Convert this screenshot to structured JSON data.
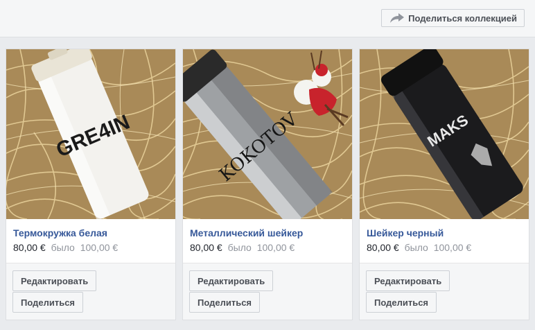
{
  "header": {
    "share_collection_label": "Поделиться коллекцией"
  },
  "products": [
    {
      "title": "Термокружка белая",
      "price": "80,00 €",
      "old_label": "было",
      "old_price": "100,00 €",
      "bottle_text": "GRE4IN",
      "edit_label": "Редактировать",
      "share_label": "Поделиться"
    },
    {
      "title": "Металлический шейкер",
      "price": "80,00 €",
      "old_label": "было",
      "old_price": "100,00 €",
      "bottle_text": "KOKOTOV",
      "edit_label": "Редактировать",
      "share_label": "Поделиться"
    },
    {
      "title": "Шейкер черный",
      "price": "80,00 €",
      "old_label": "было",
      "old_price": "100,00 €",
      "bottle_text": "MAKS",
      "edit_label": "Редактировать",
      "share_label": "Поделиться"
    }
  ],
  "colors": {
    "link": "#365899",
    "muted": "#90949c",
    "button_bg": "#f5f6f7",
    "page_bg": "#e9ebee"
  }
}
